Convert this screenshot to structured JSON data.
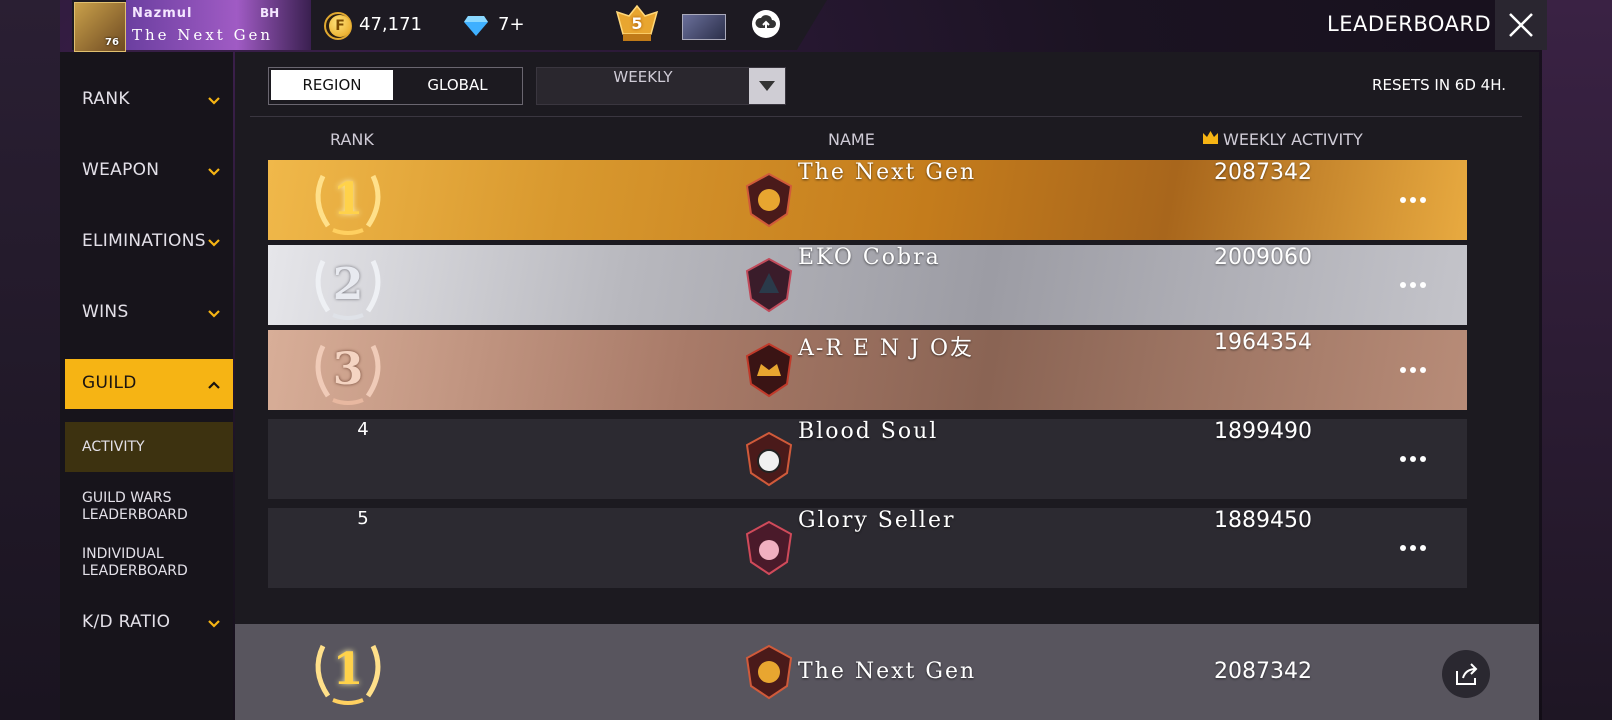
{
  "topbar": {
    "player_name": "Nazmul",
    "player_tag": "BH",
    "player_guild": "The Next Gen",
    "player_level": "76",
    "coins": "47,171",
    "diamonds": "7+",
    "rank_badge": "5",
    "title": "LEADERBOARD"
  },
  "sidebar": {
    "items": [
      {
        "label": "RANK"
      },
      {
        "label": "WEAPON"
      },
      {
        "label": "ELIMINATIONS"
      },
      {
        "label": "WINS"
      },
      {
        "label": "GUILD"
      },
      {
        "label": "K/D RATIO"
      }
    ],
    "guild_sub": [
      {
        "label": "ACTIVITY"
      },
      {
        "label": "GUILD WARS LEADERBOARD"
      },
      {
        "label": "INDIVIDUAL LEADERBOARD"
      }
    ]
  },
  "filters": {
    "region_label": "REGION",
    "global_label": "GLOBAL",
    "period": "WEEKLY",
    "reset_text": "RESETS IN 6D 4H."
  },
  "table": {
    "headers": {
      "rank": "RANK",
      "name": "NAME",
      "activity": "WEEKLY ACTIVITY"
    },
    "rows": [
      {
        "rank": "1",
        "name": "The Next Gen",
        "score": "2087342"
      },
      {
        "rank": "2",
        "name": "EKO Cobra",
        "score": "2009060"
      },
      {
        "rank": "3",
        "name": "A-R E N J O友",
        "score": "1964354"
      },
      {
        "rank": "4",
        "name": "Blood Soul",
        "score": "1899490"
      },
      {
        "rank": "5",
        "name": "Glory Seller",
        "score": "1889450"
      }
    ],
    "my_guild": {
      "rank": "1",
      "name": "The Next Gen",
      "score": "2087342"
    }
  },
  "colors": {
    "accent": "#f6b414",
    "gold": "#e8a630",
    "silver": "#b8b8be",
    "bronze": "#a87a68"
  }
}
